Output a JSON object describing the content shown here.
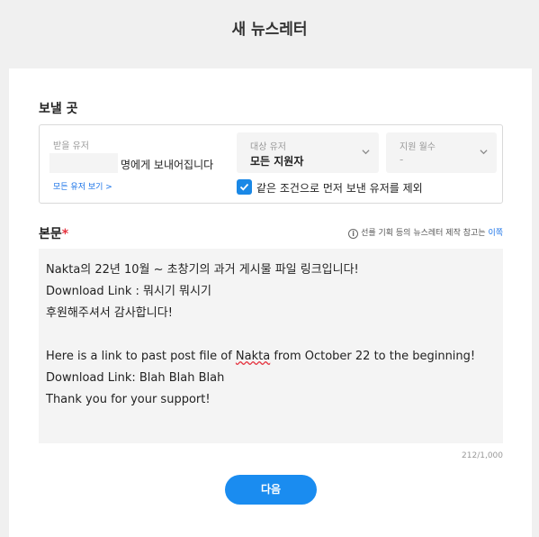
{
  "page": {
    "title": "새 뉴스레터"
  },
  "send_to": {
    "label": "보낼 곳",
    "recipient_label": "받을 유저",
    "recipient_text": "명에게 보내어집니다",
    "view_all_link": "모든 유저 보기 >",
    "target_dropdown": {
      "label": "대상 유저",
      "value": "모든 지원자"
    },
    "months_dropdown": {
      "label": "지원 월수",
      "value": "-"
    },
    "exclude_checkbox": {
      "label": "같은 조건으로 먼저 보낸 유저를 제외",
      "checked": true
    }
  },
  "body": {
    "label": "본문",
    "required_mark": "*",
    "hint_text": "선를 기획 등의 뉴스레터 제작 참고는 ",
    "hint_link": "이쪽",
    "lines": [
      "Nakta의 22년 10월 ~ 초창기의 과거 게시물 파일 링크입니다!",
      "Download Link : 뭐시기 뭐시기",
      "후원해주셔서 감사합니다!",
      "",
      "Here is a link to past post file of Nakta from October 22 to the beginning!",
      "Download Link: Blah Blah Blah",
      "Thank you for your support!"
    ],
    "counter": "212/1,000"
  },
  "actions": {
    "next_label": "다음"
  },
  "colors": {
    "accent": "#1a8cf0",
    "required": "#e5333f",
    "link": "#1a73e8"
  }
}
